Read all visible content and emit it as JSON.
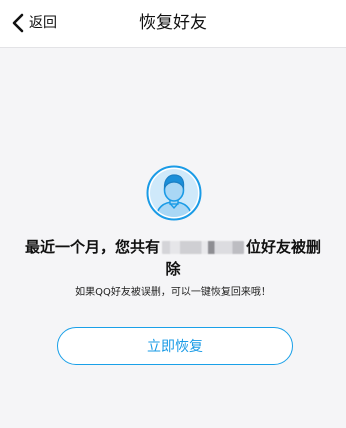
{
  "header": {
    "back_label": "返回",
    "title": "恢复好友"
  },
  "main": {
    "headline_prefix": "最近一个月，您共有",
    "headline_suffix": "位好友被删",
    "headline_wrap": "除",
    "hint": "如果QQ好友被误删，可以一键恢复回来哦！",
    "restore_button": "立即恢复"
  },
  "colors": {
    "accent": "#1A9BE6",
    "avatar_bg": "#A9D7F5",
    "background": "#F5F5F7"
  }
}
